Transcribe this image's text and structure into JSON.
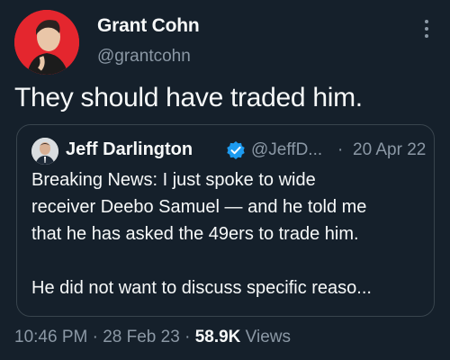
{
  "author": {
    "display_name": "Grant Cohn",
    "handle": "@grantcohn"
  },
  "tweet": {
    "text": "They should have traded him."
  },
  "quoted_tweet": {
    "display_name": "Jeff Darlington",
    "handle": "@JeffD...",
    "separator": "·",
    "date": "20 Apr 22",
    "lines": [
      "Breaking News: I just spoke to wide",
      "receiver Deebo Samuel — and he told me",
      "that he has asked the 49ers to trade him.",
      "",
      "He did not want to discuss specific reaso..."
    ]
  },
  "meta": {
    "time": "10:46 PM",
    "dot1": "·",
    "date": "28 Feb 23",
    "dot2": "·",
    "views_count": "58.9K",
    "views_label": "Views"
  },
  "colors": {
    "background": "#15202b",
    "text_primary": "#f7f9f9",
    "text_secondary": "#8b98a5",
    "border": "#38444d",
    "verified": "#1d9bf0",
    "avatar_bg": "#e4262e"
  },
  "icons": {
    "more": "more-vertical-icon",
    "verified": "verified-badge-icon"
  }
}
